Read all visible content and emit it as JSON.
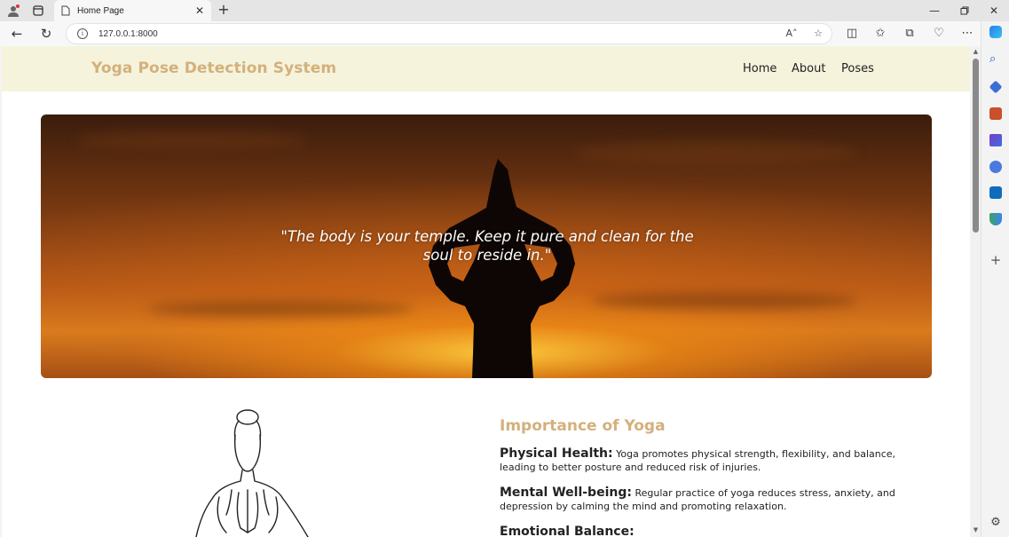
{
  "browser": {
    "tab_title": "Home Page",
    "url": "127.0.0.1:8000"
  },
  "site": {
    "brand": "Yoga Pose Detection System",
    "nav": [
      {
        "label": "Home"
      },
      {
        "label": "About"
      },
      {
        "label": "Poses"
      }
    ]
  },
  "hero": {
    "quote": "\"The body is your temple. Keep it pure and clean for the soul to reside in.\""
  },
  "importance": {
    "title": "Importance of Yoga",
    "items": [
      {
        "heading": "Physical Health:",
        "text": "Yoga promotes physical strength, flexibility, and balance, leading to better posture and reduced risk of injuries."
      },
      {
        "heading": "Mental Well-being:",
        "text": "Regular practice of yoga reduces stress, anxiety, and depression by calming the mind and promoting relaxation."
      },
      {
        "heading": "Emotional Balance:",
        "text": ""
      }
    ]
  },
  "colors": {
    "brand": "#d4b07c",
    "nav_bg": "#f5f3dc"
  }
}
